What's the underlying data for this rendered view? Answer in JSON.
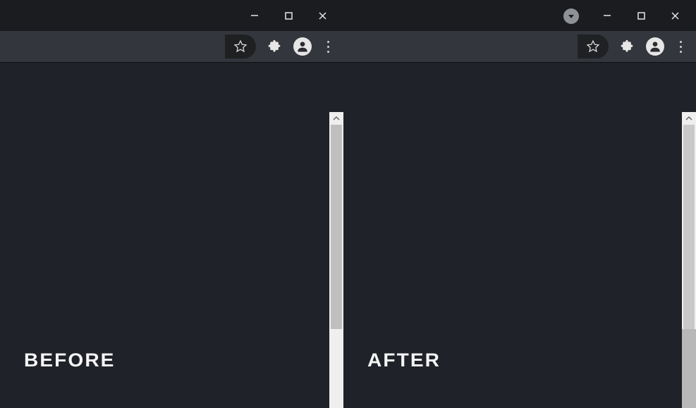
{
  "left": {
    "label": "BEFORE"
  },
  "right": {
    "label": "AFTER"
  }
}
